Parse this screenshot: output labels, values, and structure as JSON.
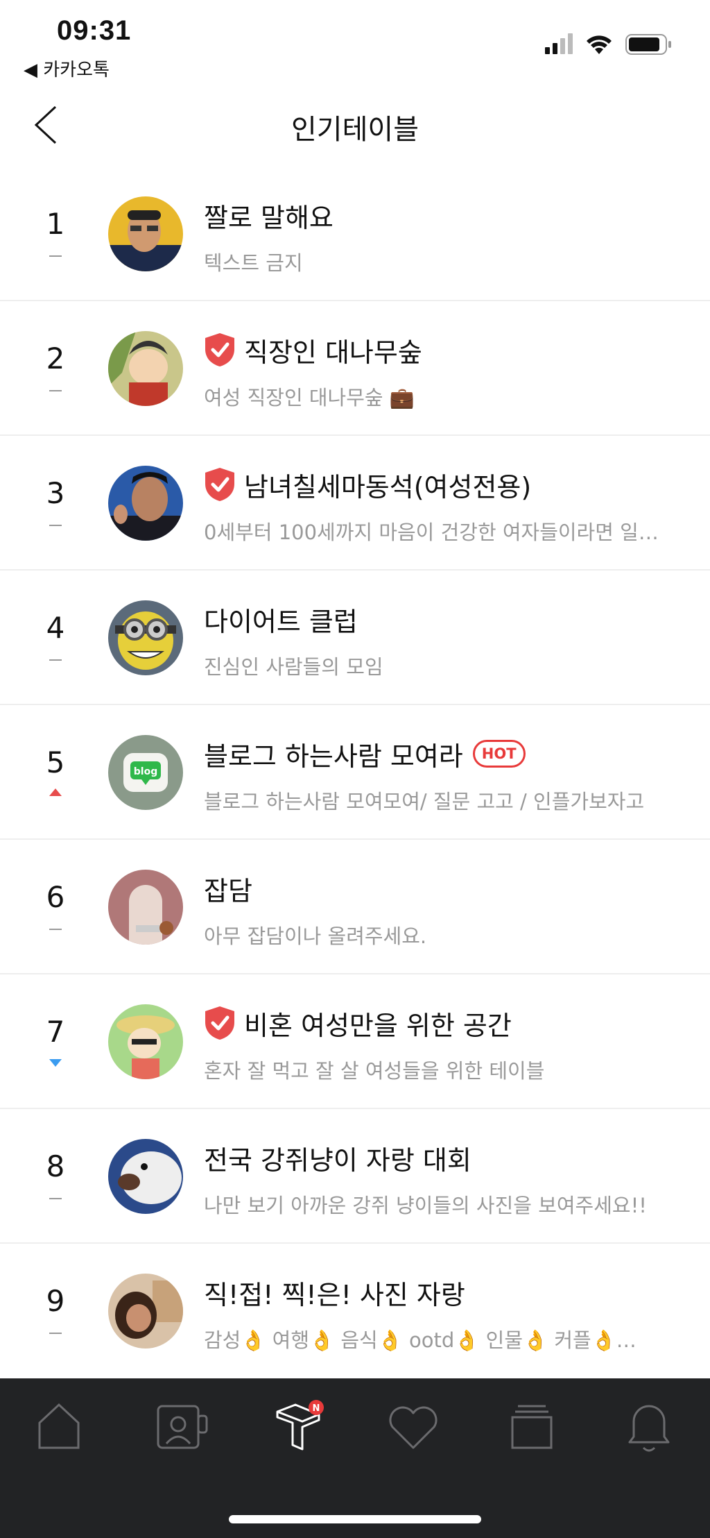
{
  "status_bar": {
    "time": "09:31",
    "back_app": "◀ 카카오톡"
  },
  "header": {
    "title": "인기테이블"
  },
  "rows": [
    {
      "rank": "1",
      "trend": "same",
      "verified": false,
      "hot": false,
      "title": "짤로 말해요",
      "desc": "텍스트 금지",
      "avatar": "person-glasses"
    },
    {
      "rank": "2",
      "trend": "same",
      "verified": true,
      "hot": false,
      "title": "직장인 대나무숲",
      "desc": "여성 직장인 대나무숲 💼",
      "avatar": "cartoon"
    },
    {
      "rank": "3",
      "trend": "same",
      "verified": true,
      "hot": false,
      "title": "남녀칠세마동석(여성전용)",
      "desc": "0세부터 100세까지 마음이 건강한 여자들이라면 일…",
      "avatar": "man"
    },
    {
      "rank": "4",
      "trend": "same",
      "verified": false,
      "hot": false,
      "title": "다이어트 클럽",
      "desc": "진심인 사람들의 모임",
      "avatar": "minion"
    },
    {
      "rank": "5",
      "trend": "up",
      "verified": false,
      "hot": true,
      "hot_label": "HOT",
      "title": "블로그 하는사람 모여라",
      "desc": "블로그 하는사람 모여모여/ 질문 고고 / 인플가보자고",
      "avatar": "blog",
      "avatar_text": "blog"
    },
    {
      "rank": "6",
      "trend": "same",
      "verified": false,
      "hot": false,
      "title": "잡담",
      "desc": "아무 잡담이나 올려주세요.",
      "avatar": "arch"
    },
    {
      "rank": "7",
      "trend": "down",
      "verified": true,
      "hot": false,
      "title": "비혼 여성만을 위한 공간",
      "desc": "혼자 잘 먹고 잘 살 여성들을 위한 테이블",
      "avatar": "cartoon-girl"
    },
    {
      "rank": "8",
      "trend": "same",
      "verified": false,
      "hot": false,
      "title": "전국 강쥐냥이 자랑 대회",
      "desc": "나만 보기 아까운 강쥐 냥이들의 사진을 보여주세요!!",
      "avatar": "dog"
    },
    {
      "rank": "9",
      "trend": "same",
      "verified": false,
      "hot": false,
      "title": "직!접! 찍!은! 사진 자랑",
      "desc": "감성👌 여행👌 음식👌 ootd👌 인물👌 커플👌…",
      "avatar": "photo"
    }
  ],
  "tabbar": {
    "tabs": [
      {
        "icon": "home-icon"
      },
      {
        "icon": "profile-card-icon"
      },
      {
        "icon": "table-icon",
        "badge": "N",
        "active": true
      },
      {
        "icon": "heart-icon"
      },
      {
        "icon": "collection-icon"
      },
      {
        "icon": "bell-icon"
      }
    ]
  },
  "colors": {
    "accent_red": "#e74c4c",
    "trend_down": "#3b9cf0",
    "tabbar_bg": "#222325"
  }
}
